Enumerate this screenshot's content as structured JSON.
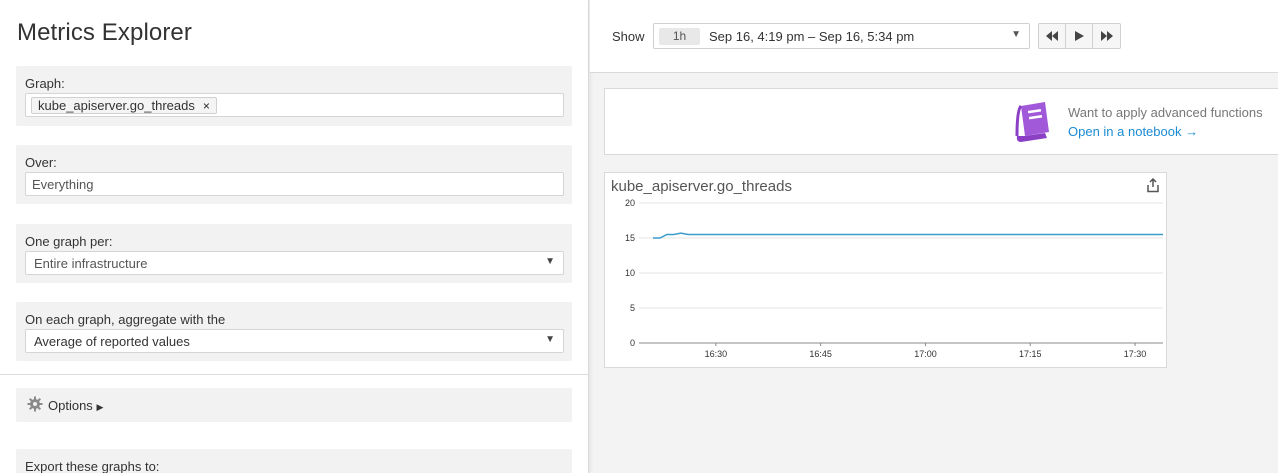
{
  "left_panel": {
    "title": "Metrics Explorer",
    "graph": {
      "label": "Graph:",
      "metric": "kube_apiserver.go_threads",
      "remove_glyph": "×"
    },
    "over": {
      "label": "Over:",
      "value": "Everything"
    },
    "one_graph_per": {
      "label": "One graph per:",
      "value": "Entire infrastructure"
    },
    "aggregate": {
      "label": "On each graph, aggregate with the",
      "value": "Average of reported values"
    },
    "options": {
      "label": "Options"
    },
    "export": {
      "label": "Export these graphs to:"
    }
  },
  "topbar": {
    "show_label": "Show",
    "time_badge": "1h",
    "time_range": "Sep 16, 4:19 pm – Sep 16, 5:34 pm",
    "nav": [
      "rewind-icon",
      "play-icon",
      "fast-forward-icon"
    ]
  },
  "banner": {
    "text": "Want to apply advanced functions",
    "link": "Open in a notebook →",
    "icon_color": "#a259d9"
  },
  "graph_card": {
    "title": "kube_apiserver.go_threads"
  },
  "chart_data": {
    "type": "line",
    "title": "kube_apiserver.go_threads",
    "xlabel": "",
    "ylabel": "",
    "ylim": [
      0,
      20
    ],
    "y_ticks": [
      0,
      5,
      10,
      15,
      20
    ],
    "x_ticks": [
      "16:30",
      "16:45",
      "17:00",
      "17:15",
      "17:30"
    ],
    "grid": true,
    "color": "#3b9ccc",
    "series": [
      {
        "x": [
          "16:21",
          "16:22",
          "16:23",
          "16:24",
          "16:25",
          "16:26",
          "16:27",
          "16:30",
          "16:45",
          "17:00",
          "17:15",
          "17:30",
          "17:34"
        ],
        "values": [
          15,
          15,
          15.5,
          15.5,
          15.7,
          15.5,
          15.5,
          15.5,
          15.5,
          15.5,
          15.5,
          15.5,
          15.5
        ]
      }
    ]
  }
}
